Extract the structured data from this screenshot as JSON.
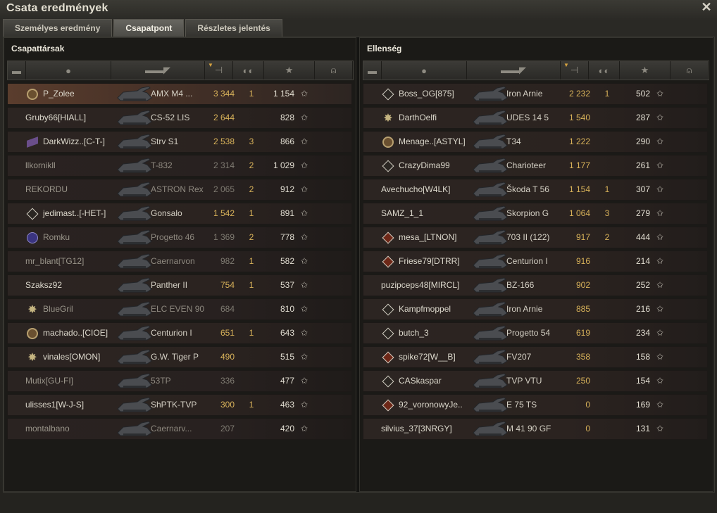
{
  "window": {
    "title": "Csata eredmények"
  },
  "tabs": [
    {
      "label": "Személyes eredmény"
    },
    {
      "label": "Csapatpont",
      "active": true
    },
    {
      "label": "Részletes jelentés"
    }
  ],
  "left": {
    "title": "Csapattársak"
  },
  "right": {
    "title": "Ellenség"
  },
  "header_icons": [
    "platoon-icon",
    "player-icon",
    "tank-icon",
    "damage-icon",
    "kills-icon",
    "xp-star-icon",
    "medal-icon"
  ],
  "allies": [
    {
      "badge": "b",
      "name": "P_Zolee",
      "vehicle": "AMX M4 ...",
      "damage": "3 344",
      "kills": "1",
      "xp": "1 154",
      "me": true
    },
    {
      "badge": "",
      "name": "Gruby66[HIALL]",
      "vehicle": "CS-52 LIS",
      "damage": "2 644",
      "kills": "",
      "xp": "828"
    },
    {
      "badge": "w",
      "name": "DarkWizz..[C-T-]",
      "vehicle": "Strv S1",
      "damage": "2 538",
      "kills": "3",
      "xp": "866"
    },
    {
      "badge": "",
      "name": "llkornikll",
      "vehicle": "T-832",
      "damage": "2 314",
      "kills": "2",
      "xp": "1 029",
      "dead": true
    },
    {
      "badge": "",
      "name": "REKORDU",
      "vehicle": "ASTRON Rex",
      "damage": "2 065",
      "kills": "2",
      "xp": "912",
      "dead": true
    },
    {
      "badge": "d",
      "name": "jedimast..[-HET-]",
      "vehicle": "Gonsalo",
      "damage": "1 542",
      "kills": "1",
      "xp": "891"
    },
    {
      "badge": "p",
      "name": "Romku",
      "vehicle": "Progetto 46",
      "damage": "1 369",
      "kills": "2",
      "xp": "778",
      "dead": true
    },
    {
      "badge": "",
      "name": "mr_blant[TG12]",
      "vehicle": "Caernarvon",
      "damage": "982",
      "kills": "1",
      "xp": "582",
      "dead": true
    },
    {
      "badge": "",
      "name": "Szaksz92",
      "vehicle": "Panther II",
      "damage": "754",
      "kills": "1",
      "xp": "537"
    },
    {
      "badge": "s",
      "name": "BlueGril",
      "vehicle": "ELC EVEN 90",
      "damage": "684",
      "kills": "",
      "xp": "810",
      "dead": true
    },
    {
      "badge": "b",
      "name": "machado..[CIOE]",
      "vehicle": "Centurion I",
      "damage": "651",
      "kills": "1",
      "xp": "643"
    },
    {
      "badge": "s",
      "name": "vinales[OMON]",
      "vehicle": "G.W. Tiger P",
      "damage": "490",
      "kills": "",
      "xp": "515"
    },
    {
      "badge": "",
      "name": "Mutix[GU-FI]",
      "vehicle": "53TP",
      "damage": "336",
      "kills": "",
      "xp": "477",
      "dead": true
    },
    {
      "badge": "",
      "name": "ulisses1[W-J-S]",
      "vehicle": "ShPTK-TVP",
      "damage": "300",
      "kills": "1",
      "xp": "463"
    },
    {
      "badge": "",
      "name": "montalbano",
      "vehicle": "Caernarv...",
      "damage": "207",
      "kills": "",
      "xp": "420",
      "dead": true
    }
  ],
  "enemies": [
    {
      "badge": "d",
      "name": "Boss_OG[875]",
      "vehicle": "Iron Arnie",
      "damage": "2 232",
      "kills": "1",
      "xp": "502"
    },
    {
      "badge": "s",
      "name": "DarthOelfi",
      "vehicle": "UDES 14 5",
      "damage": "1 540",
      "kills": "",
      "xp": "287"
    },
    {
      "badge": "b",
      "name": "Menage..[ASTYL]",
      "vehicle": "T34",
      "damage": "1 222",
      "kills": "",
      "xp": "290"
    },
    {
      "badge": "d",
      "name": "CrazyDima99",
      "vehicle": "Charioteer",
      "damage": "1 177",
      "kills": "",
      "xp": "261"
    },
    {
      "badge": "",
      "name": "Avechucho[W4LK]",
      "vehicle": "Škoda T 56",
      "damage": "1 154",
      "kills": "1",
      "xp": "307"
    },
    {
      "badge": "",
      "name": "SAMZ_1_1",
      "vehicle": "Skorpion G",
      "damage": "1 064",
      "kills": "3",
      "xp": "279"
    },
    {
      "badge": "r",
      "name": "mesa_[LTNON]",
      "vehicle": "703 II (122)",
      "damage": "917",
      "kills": "2",
      "xp": "444"
    },
    {
      "badge": "r",
      "name": "Friese79[DTRR]",
      "vehicle": "Centurion I",
      "damage": "916",
      "kills": "",
      "xp": "214"
    },
    {
      "badge": "",
      "name": "puzipceps48[MIRCL]",
      "vehicle": "BZ-166",
      "damage": "902",
      "kills": "",
      "xp": "252"
    },
    {
      "badge": "d",
      "name": "Kampfmoppel",
      "vehicle": "Iron Arnie",
      "damage": "885",
      "kills": "",
      "xp": "216"
    },
    {
      "badge": "d",
      "name": "butch_3",
      "vehicle": "Progetto 54",
      "damage": "619",
      "kills": "",
      "xp": "234"
    },
    {
      "badge": "r",
      "name": "spike72[W__B]",
      "vehicle": "FV207",
      "damage": "358",
      "kills": "",
      "xp": "158"
    },
    {
      "badge": "d",
      "name": "CASkaspar",
      "vehicle": "TVP VTU",
      "damage": "250",
      "kills": "",
      "xp": "154"
    },
    {
      "badge": "r",
      "name": "92_voronowyJe..",
      "vehicle": "E 75 TS",
      "damage": "0",
      "kills": "",
      "xp": "169"
    },
    {
      "badge": "",
      "name": "silvius_37[3NRGY]",
      "vehicle": "M 41 90 GF",
      "damage": "0",
      "kills": "",
      "xp": "131"
    }
  ],
  "colors": {
    "accent": "#d8b25a",
    "highlight_row": "#5a3d2d"
  }
}
